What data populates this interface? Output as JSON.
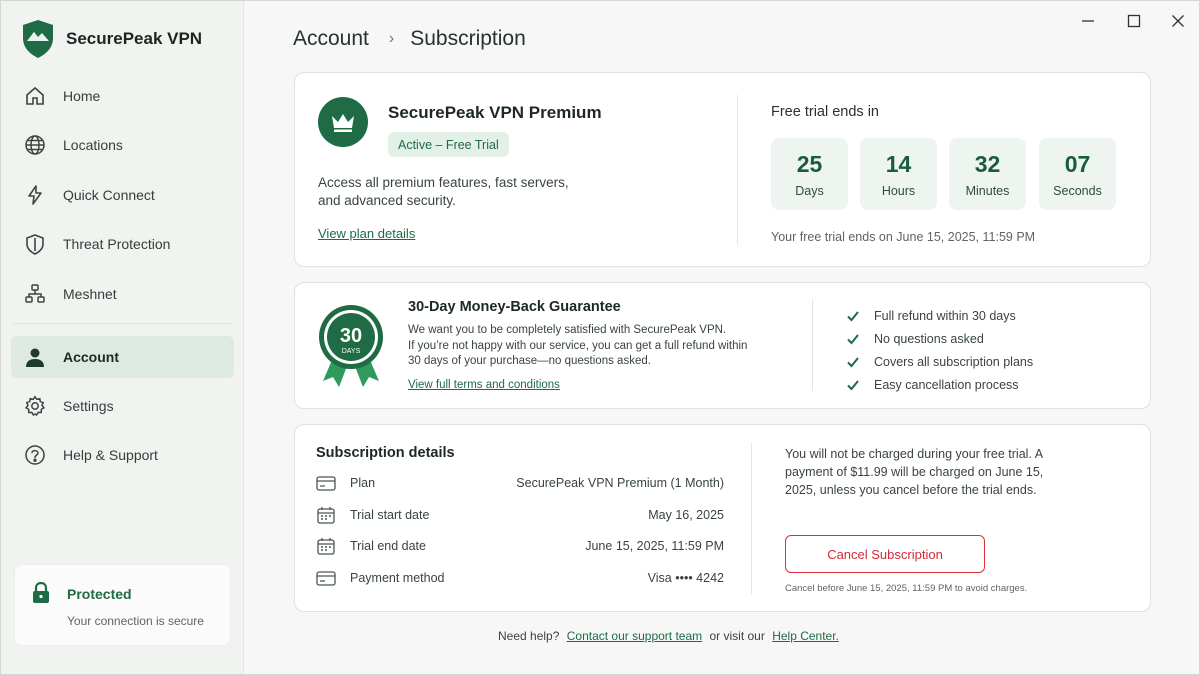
{
  "app": {
    "name": "SecurePeak VPN"
  },
  "sidebar": {
    "items": [
      {
        "label": "Home",
        "icon": "home-icon"
      },
      {
        "label": "Locations",
        "icon": "globe-icon"
      },
      {
        "label": "Quick Connect",
        "icon": "lightning-icon"
      },
      {
        "label": "Threat Protection",
        "icon": "shield-icon"
      },
      {
        "label": "Meshnet",
        "icon": "meshnet-icon"
      },
      {
        "label": "Account",
        "icon": "user-icon",
        "active": true
      },
      {
        "label": "Settings",
        "icon": "gear-icon"
      },
      {
        "label": "Help & Support",
        "icon": "help-icon"
      }
    ],
    "status": {
      "title": "Protected",
      "subtitle": "Your connection is secure"
    }
  },
  "breadcrumb": {
    "parent": "Account",
    "current": "Subscription"
  },
  "plan": {
    "title": "SecurePeak VPN Premium",
    "badge": "Active – Free Trial",
    "description": "Access all premium features, fast servers, and advanced security.",
    "link": "View plan details"
  },
  "trial": {
    "title": "Free trial ends in",
    "countdown": [
      {
        "value": "25",
        "unit": "Days"
      },
      {
        "value": "14",
        "unit": "Hours"
      },
      {
        "value": "32",
        "unit": "Minutes"
      },
      {
        "value": "07",
        "unit": "Seconds"
      }
    ],
    "note": "Your free trial ends on June 15, 2025, 11:59 PM"
  },
  "guarantee": {
    "seal_number": "30",
    "seal_label": "DAYS",
    "title": "30-Day Money-Back Guarantee",
    "text_lines": [
      "We want you to be completely satisfied with SecurePeak VPN.",
      "If you’re not happy with our service, you can get a full refund within",
      "30 days of your purchase—no questions asked."
    ],
    "link": "View full terms and conditions",
    "checks": [
      "Full refund within 30 days",
      "No questions asked",
      "Covers all subscription plans",
      "Easy cancellation process"
    ]
  },
  "subscription": {
    "title": "Subscription details",
    "rows": [
      {
        "label": "Plan",
        "value": "SecurePeak VPN Premium (1 Month)",
        "icon": "card-icon"
      },
      {
        "label": "Trial start date",
        "value": "May 16, 2025",
        "icon": "calendar-icon"
      },
      {
        "label": "Trial end date",
        "value": "June 15, 2025, 11:59 PM",
        "icon": "calendar-icon"
      },
      {
        "label": "Payment method",
        "value": "Visa •••• 4242",
        "icon": "card-icon"
      }
    ],
    "charge_note": "You will not be charged during your free trial. A payment of $11.99 will be charged on June 15, 2025, unless you cancel before the trial ends.",
    "cancel_label": "Cancel Subscription",
    "cancel_hint": "Cancel before June 15, 2025, 11:59 PM to avoid charges."
  },
  "footer": {
    "prefix": "Need help?",
    "support_link": "Contact our support team",
    "middle": "or visit our",
    "help_link": "Help Center."
  },
  "colors": {
    "brand": "#1e6b45",
    "accent_light": "#e3f0e8",
    "danger": "#d9303b"
  }
}
